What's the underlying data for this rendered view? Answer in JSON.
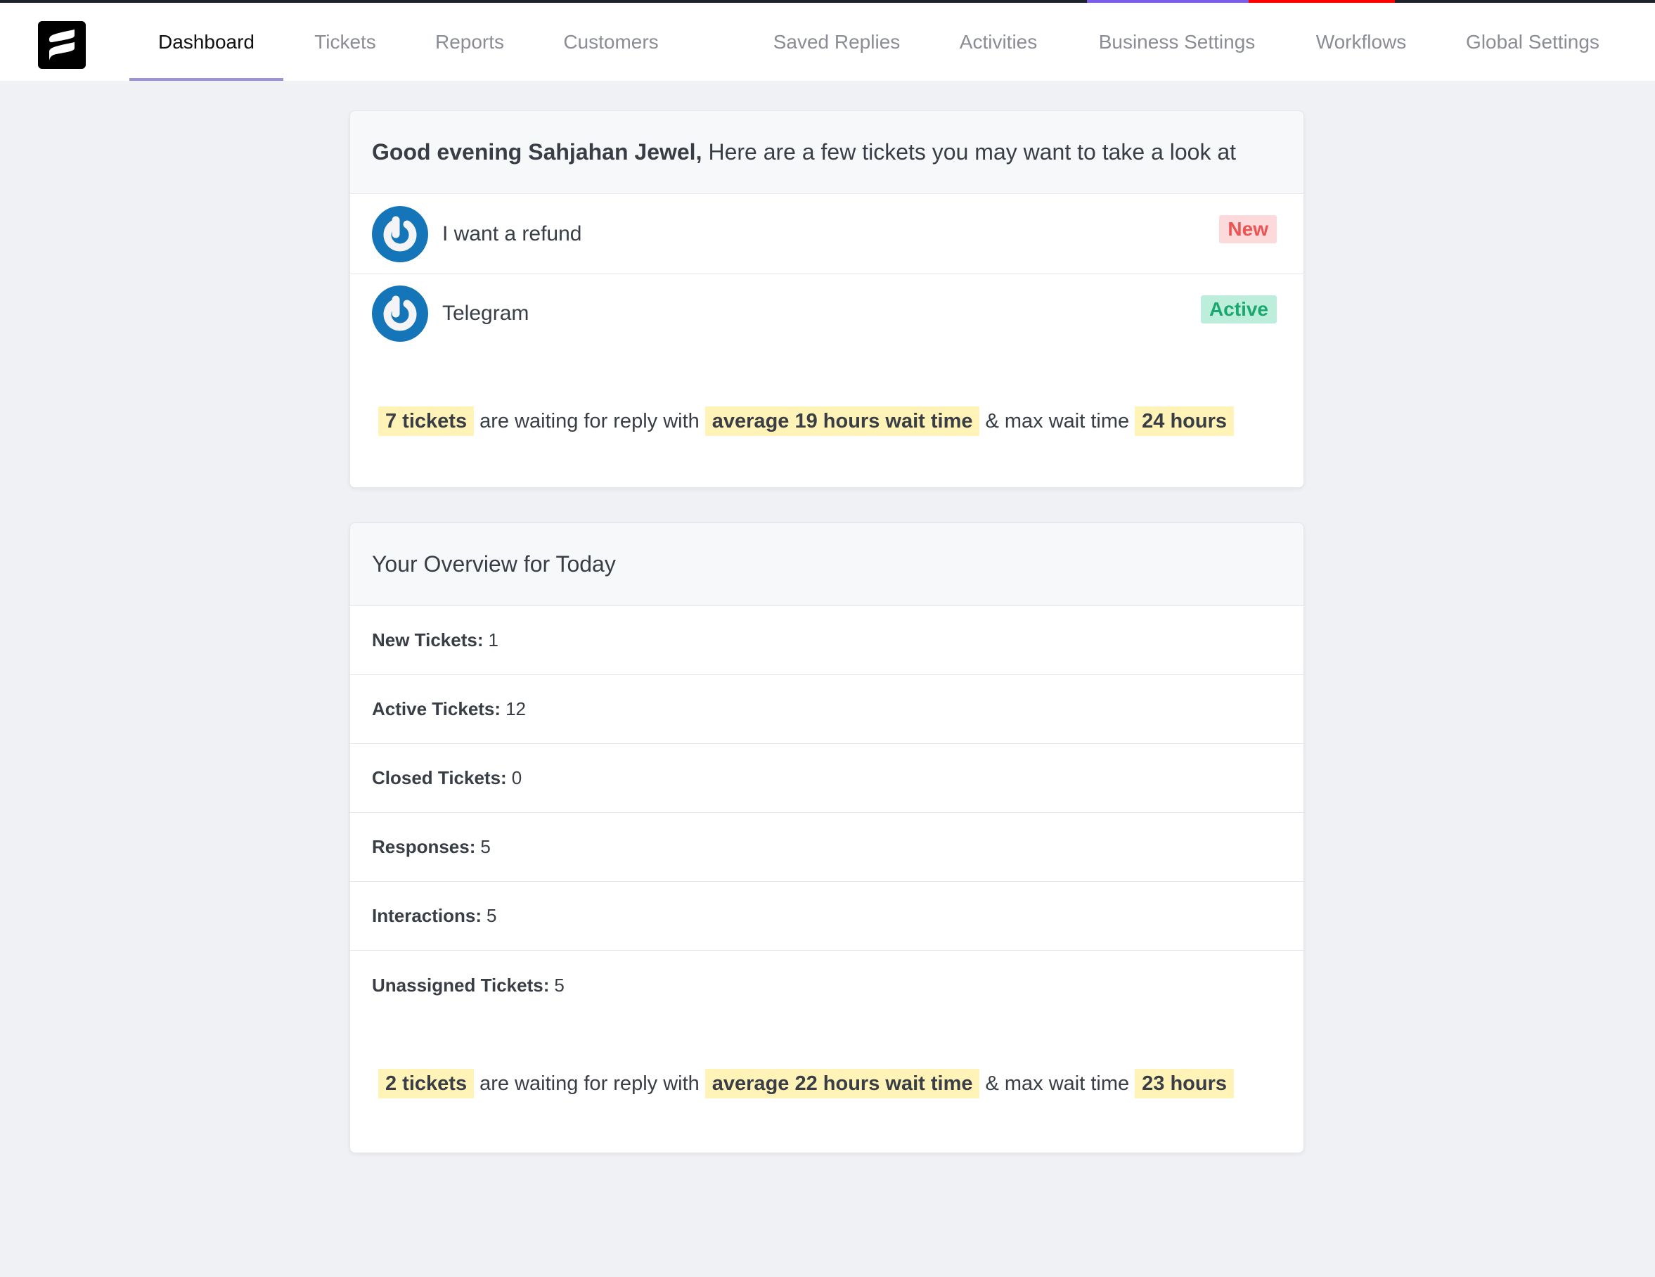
{
  "topbar": {
    "accent_colors": [
      "#7a5de8",
      "#ff0000"
    ]
  },
  "nav": {
    "logo": "fluent-support-logo",
    "items": [
      {
        "label": "Dashboard",
        "active": true
      },
      {
        "label": "Tickets",
        "active": false
      },
      {
        "label": "Reports",
        "active": false
      },
      {
        "label": "Customers",
        "active": false
      },
      {
        "label": "Saved Replies",
        "active": false
      },
      {
        "label": "Activities",
        "active": false
      },
      {
        "label": "Business Settings",
        "active": false
      },
      {
        "label": "Workflows",
        "active": false
      },
      {
        "label": "Global Settings",
        "active": false
      }
    ]
  },
  "greeting_card": {
    "greeting_bold": "Good evening Sahjahan Jewel,",
    "greeting_rest": "Here are a few tickets you may want to take a look at",
    "tickets": [
      {
        "title": "I want a refund",
        "status": "New",
        "avatar": "gravatar-icon"
      },
      {
        "title": "Telegram",
        "status": "Active",
        "avatar": "gravatar-icon"
      }
    ],
    "waiting": {
      "count": "7 tickets",
      "text1": "are waiting for reply with",
      "average": "average 19 hours wait time",
      "text2": "& max wait time",
      "max": "24 hours"
    }
  },
  "overview_card": {
    "title": "Your Overview for Today",
    "stats": [
      {
        "label": "New Tickets:",
        "value": "1"
      },
      {
        "label": "Active Tickets:",
        "value": "12"
      },
      {
        "label": "Closed Tickets:",
        "value": "0"
      },
      {
        "label": "Responses:",
        "value": "5"
      },
      {
        "label": "Interactions:",
        "value": "5"
      },
      {
        "label": "Unassigned Tickets:",
        "value": "5"
      }
    ],
    "waiting": {
      "count": "2 tickets",
      "text1": "are waiting for reply with",
      "average": "average 22 hours wait time",
      "text2": "& max wait time",
      "max": "23 hours"
    }
  },
  "colors": {
    "badge_new_bg": "#fcd9da",
    "badge_new_text": "#ec5454",
    "badge_active_bg": "#bdeedb",
    "badge_active_text": "#1aa86e",
    "highlight": "#fff3b8",
    "active_tab_underline": "#9d93d8"
  }
}
